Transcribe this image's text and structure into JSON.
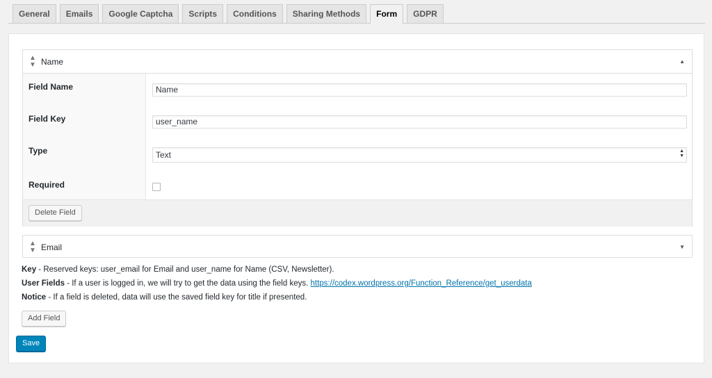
{
  "tabs": [
    "General",
    "Emails",
    "Google Captcha",
    "Scripts",
    "Conditions",
    "Sharing Methods",
    "Form",
    "GDPR"
  ],
  "active_tab": "Form",
  "fields": [
    {
      "title": "Name",
      "expanded": true,
      "labels": {
        "field_name": "Field Name",
        "field_key": "Field Key",
        "type": "Type",
        "required": "Required"
      },
      "values": {
        "field_name": "Name",
        "field_key": "user_name",
        "type": "Text",
        "required": false
      },
      "delete_label": "Delete Field"
    },
    {
      "title": "Email",
      "expanded": false
    }
  ],
  "notes": {
    "key_label": "Key",
    "key_text": " - Reserved keys: user_email for Email and user_name for Name (CSV, Newsletter).",
    "user_fields_label": "User Fields",
    "user_fields_text": " - If a user is logged in, we will try to get the data using the field keys. ",
    "user_fields_link": "https://codex.wordpress.org/Function_Reference/get_userdata",
    "notice_label": "Notice",
    "notice_text": " - If a field is deleted, data will use the saved field key for title if presented."
  },
  "add_field_label": "Add Field",
  "save_label": "Save",
  "colors": {
    "primary": "#0085ba",
    "link": "#0073aa"
  }
}
